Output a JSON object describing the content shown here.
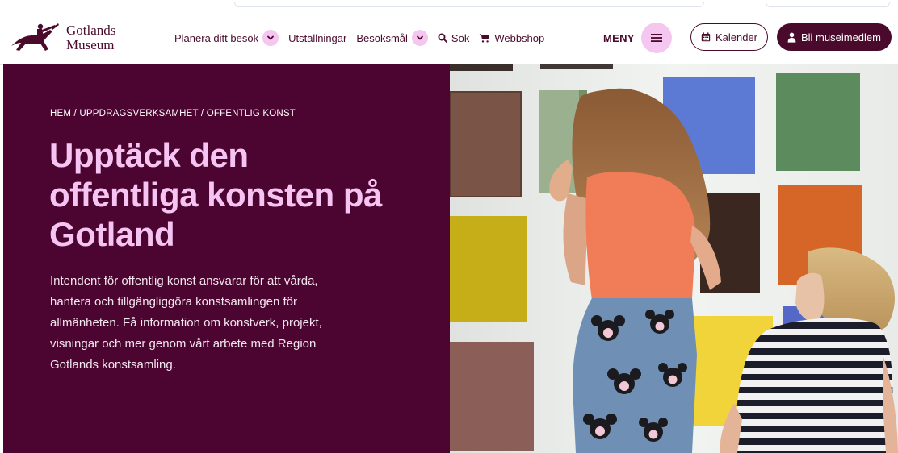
{
  "logo": {
    "line1": "Gotlands",
    "line2": "Museum"
  },
  "nav": {
    "items": [
      {
        "label": "Planera ditt besök",
        "has_dropdown": true
      },
      {
        "label": "Utställningar",
        "has_dropdown": false
      },
      {
        "label": "Besöksmål",
        "has_dropdown": true
      },
      {
        "label": "Sök",
        "icon": "search-icon"
      },
      {
        "label": "Webbshop",
        "icon": "cart-icon"
      }
    ]
  },
  "menu": {
    "label": "MENY",
    "icon": "hamburger-icon"
  },
  "buttons": {
    "calendar": {
      "label": "Kalender",
      "icon": "calendar-icon"
    },
    "member": {
      "label": "Bli museimedlem",
      "icon": "user-badge-icon"
    }
  },
  "hero": {
    "breadcrumb": "HEM / UPPDRAGSVERKSAMHET / OFFENTLIG KONST",
    "title": "Upptäck den offentliga konsten på Gotland",
    "description": "Intendent för offentlig konst ansvarar för att vårda, hantera och tillgängliggöra konstsamlingen för allmänheten. Få information om konstverk, projekt, visningar och mer genom vårt arbete med Region Gotlands konstsamling."
  },
  "colors": {
    "brand": "#4a0a2c",
    "hero_bg": "#4c0530",
    "accent_pink": "#f4c6f0",
    "title_pink": "#f6c4f2"
  }
}
